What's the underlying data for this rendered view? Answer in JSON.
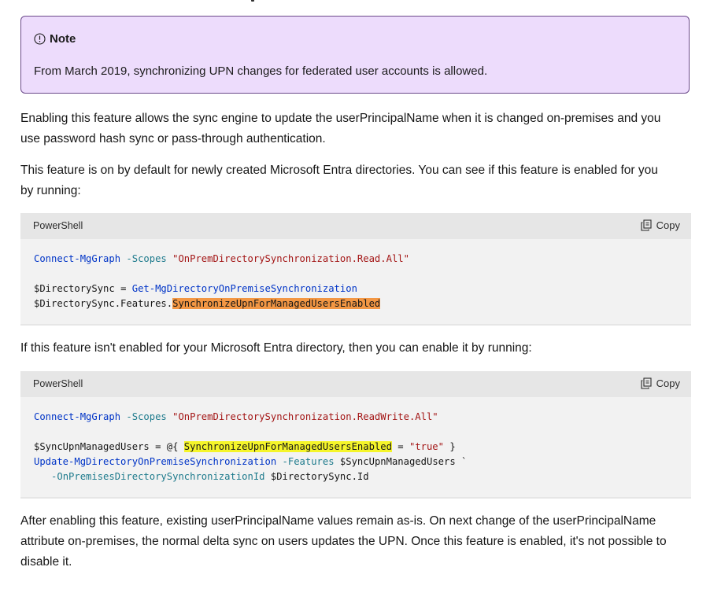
{
  "note": {
    "title": "Note",
    "text": "From March 2019, synchronizing UPN changes for federated user accounts is allowed."
  },
  "paragraphs": {
    "p1_line1": "Enabling this feature allows the sync engine to update the userPrincipalName when it is changed on-premises and you",
    "p1_line2": "use password hash sync or pass-through authentication.",
    "p2_line1": "This feature is on by default for newly created Microsoft Entra directories. You can see if this feature is enabled for you",
    "p2_line2": "by running:",
    "p3": "If this feature isn't enabled for your Microsoft Entra directory, then you can enable it by running:",
    "p4_line1": "After enabling this feature, existing userPrincipalName values remain as-is. On next change of the userPrincipalName",
    "p4_line2": "attribute on-premises, the normal delta sync on users updates the UPN. Once this feature is enabled, it's not possible to",
    "p4_line3": "disable it."
  },
  "code_block_1": {
    "language": "PowerShell",
    "copy_label": "Copy",
    "line1": {
      "cmd": "Connect-MgGraph",
      "param": "-Scopes",
      "str": "\"OnPremDirectorySynchronization.Read.All\""
    },
    "line3": {
      "var": "$DirectorySync",
      "eq": " = ",
      "cmd": "Get-MgDirectoryOnPremiseSynchronization"
    },
    "line4": {
      "prefix": "$DirectorySync.Features.",
      "highlight": "SynchronizeUpnForManagedUsersEnabled"
    }
  },
  "code_block_2": {
    "language": "PowerShell",
    "copy_label": "Copy",
    "line1": {
      "cmd": "Connect-MgGraph",
      "param": "-Scopes",
      "str": "\"OnPremDirectorySynchronization.ReadWrite.All\""
    },
    "line3": {
      "prefix": "$SyncUpnManagedUsers = @{ ",
      "highlight": "SynchronizeUpnForManagedUsersEnabled",
      "eq": " = ",
      "str": "\"true\"",
      "suffix": " }"
    },
    "line4": {
      "cmd": "Update-MgDirectoryOnPremiseSynchronization",
      "param": "-Features",
      "var": "$SyncUpnManagedUsers `"
    },
    "line5": {
      "indent": "   ",
      "param": "-OnPremisesDirectorySynchronizationId",
      "var": "$DirectorySync.Id"
    }
  },
  "colors": {
    "note_bg": "#eddcfc",
    "note_border": "#6b4a8a",
    "code_bg": "#f2f2f2",
    "code_header_bg": "#e6e6e6",
    "highlight_orange": "#f39744",
    "highlight_yellow": "#f5f52a",
    "cmdlet_blue": "#0034c7",
    "param_teal": "#1d7a8c",
    "string_red": "#a31515"
  },
  "icons": {
    "note": "info-circle-icon",
    "copy": "copy-icon"
  }
}
